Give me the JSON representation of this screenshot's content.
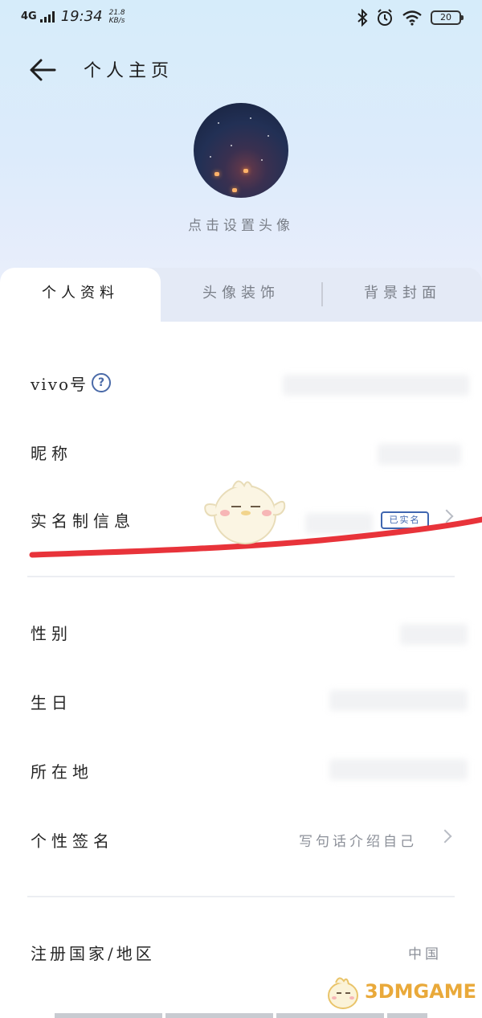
{
  "status_bar": {
    "network": "4G",
    "time": "19:34",
    "speed": "21.8 KB/s",
    "battery": "20"
  },
  "header": {
    "title": "个人主页",
    "avatar_hint": "点击设置头像"
  },
  "tabs": [
    {
      "label": "个人资料",
      "active": true
    },
    {
      "label": "头像装饰",
      "active": false
    },
    {
      "label": "背景封面",
      "active": false
    }
  ],
  "profile": {
    "vivo_id_label": "vivo号",
    "nickname_label": "昵称",
    "realname_label": "实名制信息",
    "realname_badge": "已实名",
    "gender_label": "性别",
    "birthday_label": "生日",
    "location_label": "所在地",
    "signature_label": "个性签名",
    "signature_placeholder": "写句话介绍自己",
    "region_label": "注册国家/地区",
    "region_value": "中国"
  },
  "watermark": {
    "text": "3DMGAME"
  },
  "colors": {
    "accent": "#3f66b0",
    "red_mark": "#e8333a",
    "watermark": "#e9a93a"
  }
}
